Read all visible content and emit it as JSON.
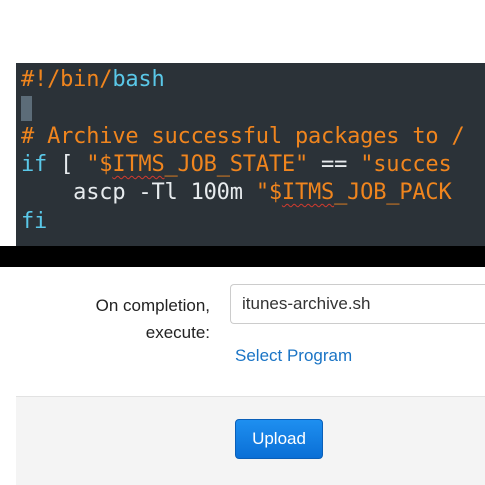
{
  "script_editor": {
    "lines": [
      {
        "segments": [
          {
            "text": "#!/",
            "cls": "c-comment"
          },
          {
            "text": "bin",
            "cls": "c-comment"
          },
          {
            "text": "/",
            "cls": "c-comment"
          },
          {
            "text": "bash",
            "cls": "c-keyword"
          }
        ]
      },
      {
        "segments": [
          {
            "text": "",
            "cls": "c-plain"
          }
        ]
      },
      {
        "segments": [
          {
            "text": "# Archive successful packages to /",
            "cls": "c-comment"
          }
        ]
      },
      {
        "segments": [
          {
            "text": "if",
            "cls": "c-keyword"
          },
          {
            "text": " [ ",
            "cls": "c-plain"
          },
          {
            "text": "\"$",
            "cls": "c-string"
          },
          {
            "text": "ITMS",
            "cls": "c-var"
          },
          {
            "text": "_JOB_STATE\"",
            "cls": "c-string"
          },
          {
            "text": " == ",
            "cls": "c-plain"
          },
          {
            "text": "\"succes",
            "cls": "c-string"
          }
        ]
      },
      {
        "segments": [
          {
            "text": "    ascp -Tl 100m ",
            "cls": "c-plain"
          },
          {
            "text": "\"$",
            "cls": "c-string"
          },
          {
            "text": "ITMS",
            "cls": "c-var"
          },
          {
            "text": "_JOB_PACK",
            "cls": "c-string"
          }
        ]
      },
      {
        "segments": [
          {
            "text": "fi",
            "cls": "c-keyword"
          }
        ]
      }
    ]
  },
  "form": {
    "completion_label_line1": "On completion,",
    "completion_label_line2": "execute:",
    "program_value": "itunes-archive.sh",
    "select_program_label": "Select Program",
    "upload_label": "Upload"
  },
  "colors": {
    "editor_background": "#2b3238",
    "comment": "#f0851e",
    "keyword": "#5ac8e8",
    "link": "#1a74c5",
    "button": "#0a6fd6"
  }
}
